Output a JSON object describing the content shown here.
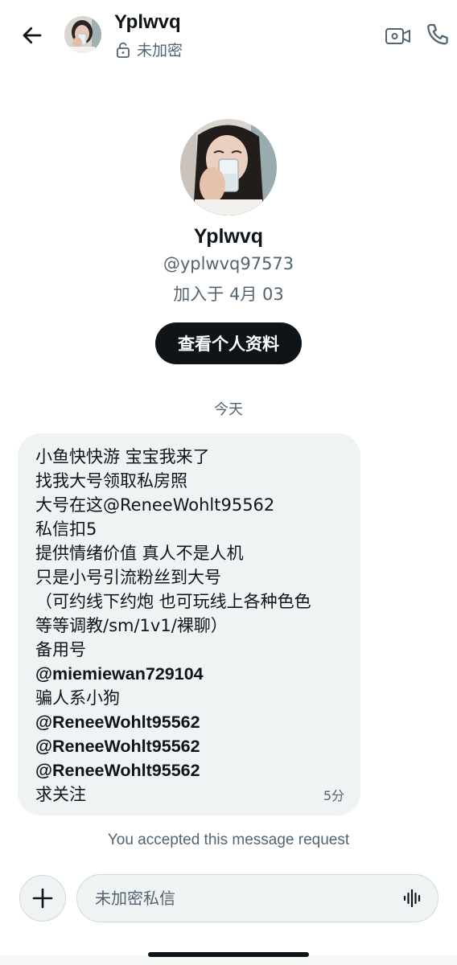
{
  "header": {
    "name": "Yplwvq",
    "encryption_status": "未加密"
  },
  "profile": {
    "name": "Yplwvq",
    "handle": "@yplwvq97573",
    "joined": "加入于 4月 03",
    "view_profile_label": "查看个人资料"
  },
  "date_separator": "今天",
  "message": {
    "lines": [
      "小鱼快快游 宝宝我来了",
      "找我大号领取私房照",
      "大号在这@ReneeWohlt95562",
      "私信扣5",
      "提供情绪价值 真人不是人机",
      "只是小号引流粉丝到大号",
      "（可约线下约炮 也可玩线上各种色色",
      "等等调教/sm/1v1/裸聊）",
      "备用号",
      "@miemiewan729104",
      "骗人系小狗",
      "@ReneeWohlt95562",
      "@ReneeWohlt95562",
      "@ReneeWohlt95562",
      "求关注"
    ],
    "time": "5分"
  },
  "accepted_note": "You accepted this message request",
  "composer": {
    "placeholder": "未加密私信"
  },
  "icons": {
    "back": "arrow-left-icon",
    "lock": "unlock-icon",
    "video": "video-camera-icon",
    "phone": "phone-icon",
    "add": "plus-icon",
    "voice": "voice-waveform-icon"
  },
  "colors": {
    "text_primary": "#0f1419",
    "text_secondary": "#536471",
    "bubble_bg": "#eff3f4",
    "button_bg": "#0f1419"
  }
}
